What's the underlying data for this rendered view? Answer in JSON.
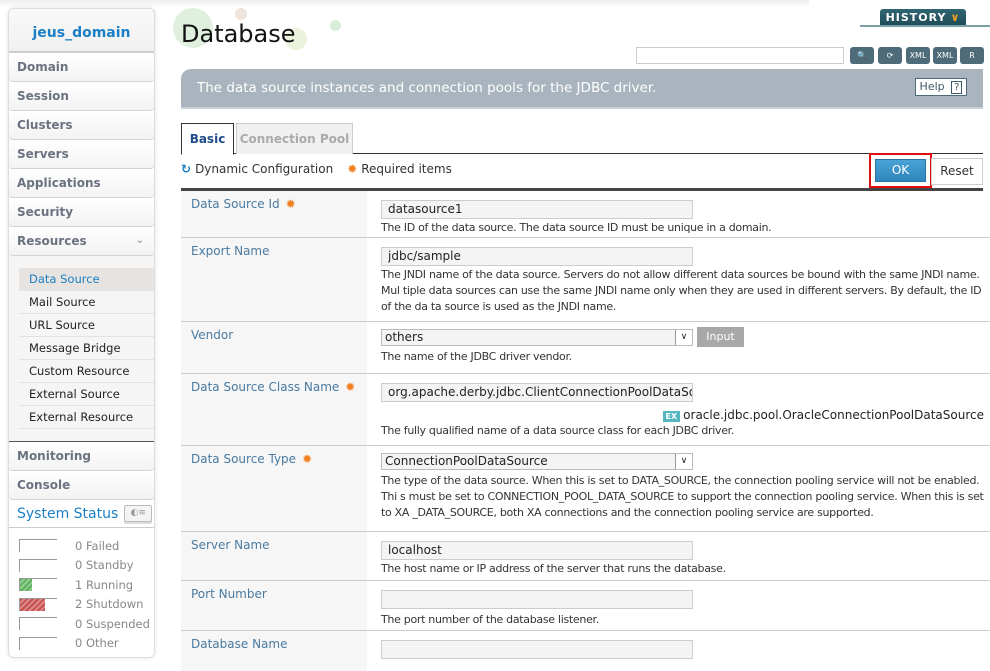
{
  "sidebar": {
    "domain": "jeus_domain",
    "nav": [
      {
        "label": "Domain"
      },
      {
        "label": "Session"
      },
      {
        "label": "Clusters"
      },
      {
        "label": "Servers"
      },
      {
        "label": "Applications"
      },
      {
        "label": "Security"
      },
      {
        "label": "Resources",
        "expanded": true
      }
    ],
    "resources": [
      {
        "label": "Data Source",
        "active": true
      },
      {
        "label": "Mail Source"
      },
      {
        "label": "URL Source"
      },
      {
        "label": "Message Bridge"
      },
      {
        "label": "Custom Resource"
      },
      {
        "label": "External Source"
      },
      {
        "label": "External Resource"
      }
    ],
    "nav_bottom": [
      {
        "label": "Monitoring"
      },
      {
        "label": "Console"
      }
    ],
    "system_status": {
      "title": "System Status",
      "items": [
        {
          "count": 0,
          "label": "0 Failed"
        },
        {
          "count": 0,
          "label": "0 Standby"
        },
        {
          "count": 1,
          "label": "1 Running",
          "color": "#5fae5f"
        },
        {
          "count": 2,
          "label": "2 Shutdown",
          "color": "#c45050"
        },
        {
          "count": 0,
          "label": "0 Suspended"
        },
        {
          "count": 0,
          "label": "0 Other"
        }
      ]
    }
  },
  "header": {
    "title": "Database",
    "history_label": "HISTORY",
    "search_value": "",
    "tools": [
      "search-icon",
      "refresh-icon",
      "export-xml-icon",
      "import-xml-icon",
      "record-icon"
    ]
  },
  "banner": {
    "text": "The data source instances and connection pools for the JDBC driver.",
    "help_label": "Help",
    "help_icon": "?"
  },
  "tabs": [
    {
      "label": "Basic",
      "active": true
    },
    {
      "label": "Connection Pool",
      "active": false
    }
  ],
  "legend": {
    "dynamic": "Dynamic Configuration",
    "required": "Required items"
  },
  "actions": {
    "ok": "OK",
    "reset": "Reset"
  },
  "form": {
    "data_source_id": {
      "label": "Data Source Id",
      "required": true,
      "value": "datasource1",
      "desc": "The ID of the data source. The data source ID must be unique in a domain."
    },
    "export_name": {
      "label": "Export Name",
      "required": false,
      "value": "jdbc/sample",
      "desc": "The JNDI name of the data source. Servers do not allow different data sources be bound with the same JNDI name. Mul tiple data sources can use the same JNDI name only when they are used in different servers. By default, the ID of the da ta source is used as the JNDI name."
    },
    "vendor": {
      "label": "Vendor",
      "required": false,
      "value": "others",
      "button": "Input",
      "desc": "The name of the JDBC driver vendor."
    },
    "class_name": {
      "label": "Data Source Class Name",
      "required": true,
      "value": "org.apache.derby.jdbc.ClientConnectionPoolDataSour",
      "example_badge": "EX",
      "example": "oracle.jdbc.pool.OracleConnectionPoolDataSource",
      "desc": "The fully qualified name of a data source class for each JDBC driver."
    },
    "data_source_type": {
      "label": "Data Source Type",
      "required": true,
      "value": "ConnectionPoolDataSource",
      "desc": "The type of the data source. When this is set to DATA_SOURCE, the connection pooling service will not be enabled. Thi s must be set to CONNECTION_POOL_DATA_SOURCE to support the connection pooling service. When this is set to XA _DATA_SOURCE, both XA connections and the connection pooling service are supported."
    },
    "server_name": {
      "label": "Server Name",
      "required": false,
      "value": "localhost",
      "desc": "The host name or IP address of the server that runs the database."
    },
    "port_number": {
      "label": "Port Number",
      "required": false,
      "value": "",
      "desc": "The port number of the database listener."
    },
    "database_name": {
      "label": "Database Name",
      "required": false,
      "value": ""
    }
  }
}
